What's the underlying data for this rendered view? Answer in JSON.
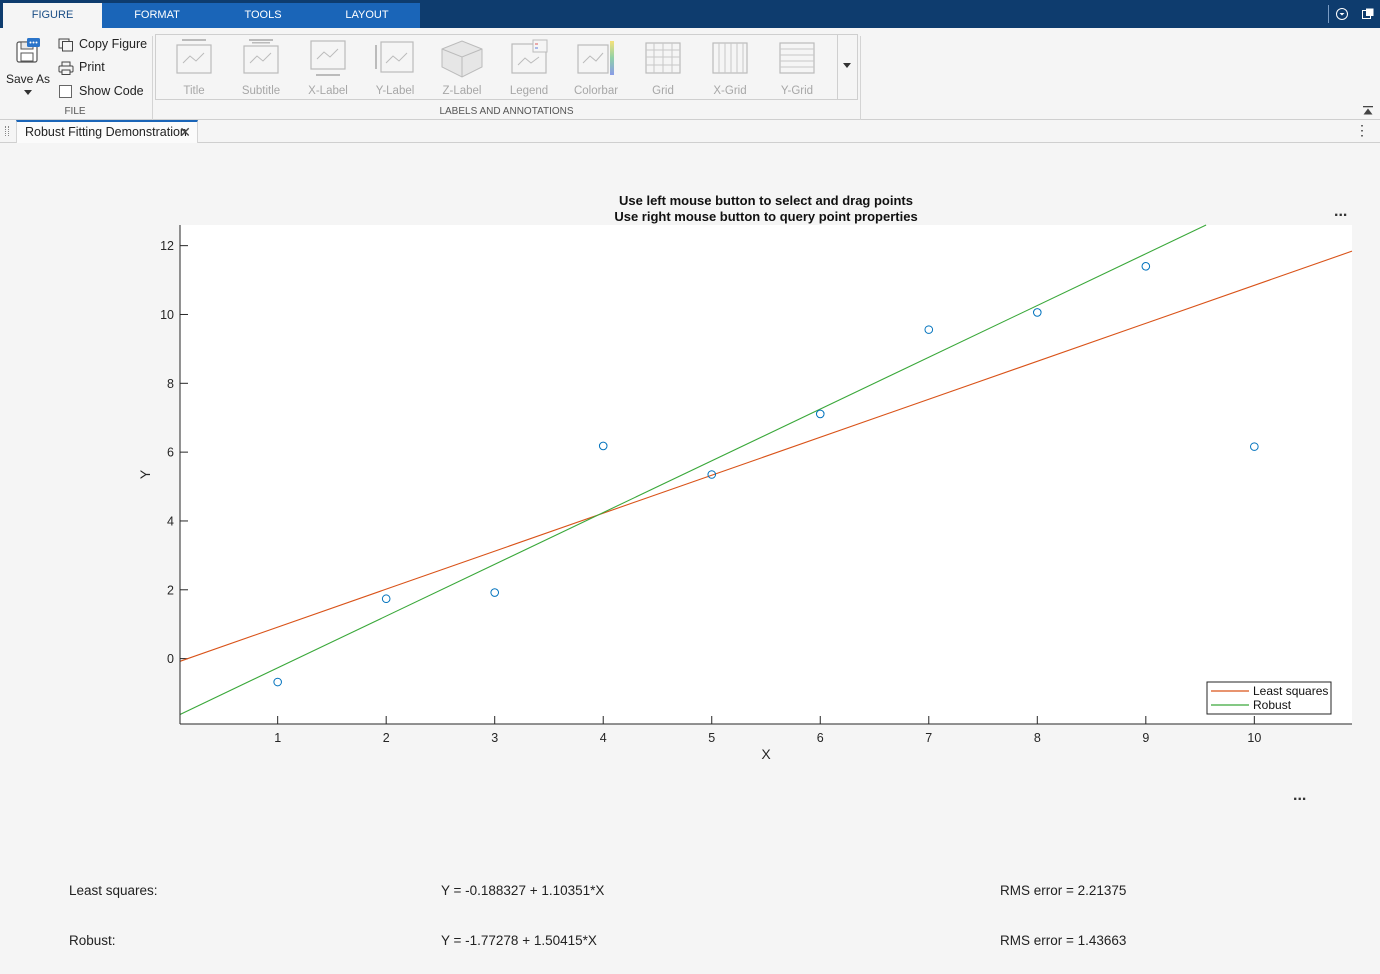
{
  "ribbon_tabs": [
    "FIGURE",
    "FORMAT",
    "TOOLS",
    "LAYOUT"
  ],
  "file_group": {
    "save_as": "Save As",
    "copy_figure": "Copy Figure",
    "print": "Print",
    "show_code": "Show Code",
    "show_code_checked": false,
    "label": "FILE"
  },
  "labels_group": {
    "items": [
      "Title",
      "Subtitle",
      "X-Label",
      "Y-Label",
      "Z-Label",
      "Legend",
      "Colorbar",
      "Grid",
      "X-Grid",
      "Y-Grid"
    ],
    "label": "LABELS AND ANNOTATIONS"
  },
  "document_tab": {
    "title": "Robust Fitting Demonstration"
  },
  "menus": {
    "axes_more": "...",
    "figure_more": "..."
  },
  "chart_data": {
    "type": "scatter",
    "title": [
      "Use left mouse button to select and drag points",
      "Use right mouse button to query point properties"
    ],
    "xlabel": "X",
    "ylabel": "Y",
    "xlim": [
      0.1,
      10.9
    ],
    "ylim": [
      -1.9,
      12.6
    ],
    "xticks": [
      1,
      2,
      3,
      4,
      5,
      6,
      7,
      8,
      9,
      10
    ],
    "yticks": [
      0,
      2,
      4,
      6,
      8,
      10,
      12
    ],
    "grid": false,
    "legend_position": "bottom-right",
    "points": {
      "x": [
        1,
        2,
        3,
        4,
        5,
        6,
        7,
        8,
        9,
        10
      ],
      "y": [
        -0.68,
        1.74,
        1.92,
        6.18,
        5.35,
        7.11,
        9.56,
        10.06,
        11.4,
        6.16
      ],
      "color": "#0072bd"
    },
    "series": [
      {
        "name": "Least squares",
        "intercept": -0.188327,
        "slope": 1.10351,
        "color": "#d95319"
      },
      {
        "name": "Robust",
        "intercept": -1.77278,
        "slope": 1.50415,
        "color": "#3aa83a"
      }
    ]
  },
  "results": {
    "least_squares": {
      "label": "Least squares:",
      "equation": "Y = -0.188327 + 1.10351*X",
      "rms": "RMS error = 2.21375"
    },
    "robust": {
      "label": "Robust:",
      "equation": "Y = -1.77278 + 1.50415*X",
      "rms": "RMS error = 1.43663"
    }
  }
}
